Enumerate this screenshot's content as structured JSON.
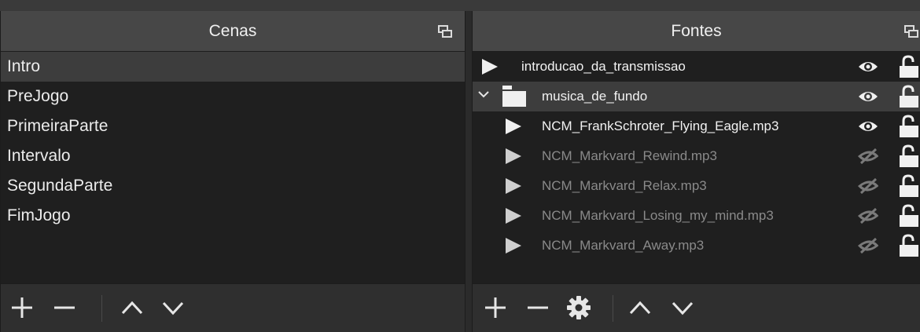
{
  "scenes": {
    "title": "Cenas",
    "items": [
      {
        "label": "Intro",
        "selected": true
      },
      {
        "label": "PreJogo",
        "selected": false
      },
      {
        "label": "PrimeiraParte",
        "selected": false
      },
      {
        "label": "Intervalo",
        "selected": false
      },
      {
        "label": "SegundaParte",
        "selected": false
      },
      {
        "label": "FimJogo",
        "selected": false
      }
    ],
    "toolbar": [
      "add-icon",
      "remove-icon",
      "move-up-icon",
      "move-down-icon"
    ]
  },
  "sources": {
    "title": "Fontes",
    "items": [
      {
        "label": "introducao_da_transmissao",
        "icon": "play-icon",
        "visible": true,
        "locked": false,
        "nested": false
      },
      {
        "label": "musica_de_fundo",
        "icon": "folder-icon",
        "group": true,
        "expanded": true,
        "visible": true,
        "locked": false,
        "selected": true
      },
      {
        "label": "NCM_FrankSchroter_Flying_Eagle.mp3",
        "icon": "play-icon",
        "visible": true,
        "locked": false,
        "nested": true
      },
      {
        "label": "NCM_Markvard_Rewind.mp3",
        "icon": "play-icon",
        "visible": false,
        "locked": false,
        "nested": true
      },
      {
        "label": "NCM_Markvard_Relax.mp3",
        "icon": "play-icon",
        "visible": false,
        "locked": false,
        "nested": true
      },
      {
        "label": "NCM_Markvard_Losing_my_mind.mp3",
        "icon": "play-icon",
        "visible": false,
        "locked": false,
        "nested": true
      },
      {
        "label": "NCM_Markvard_Away.mp3",
        "icon": "play-icon",
        "visible": false,
        "locked": false,
        "nested": true
      }
    ],
    "toolbar": [
      "add-icon",
      "remove-icon",
      "gear-icon",
      "move-up-icon",
      "move-down-icon"
    ]
  },
  "colors": {
    "panel_bg": "#1f1f1f",
    "title_bg": "#474747",
    "selected_bg": "#3d3d3d",
    "toolbar_bg": "#2f2f2f",
    "hidden_text": "#8a8a8a"
  }
}
